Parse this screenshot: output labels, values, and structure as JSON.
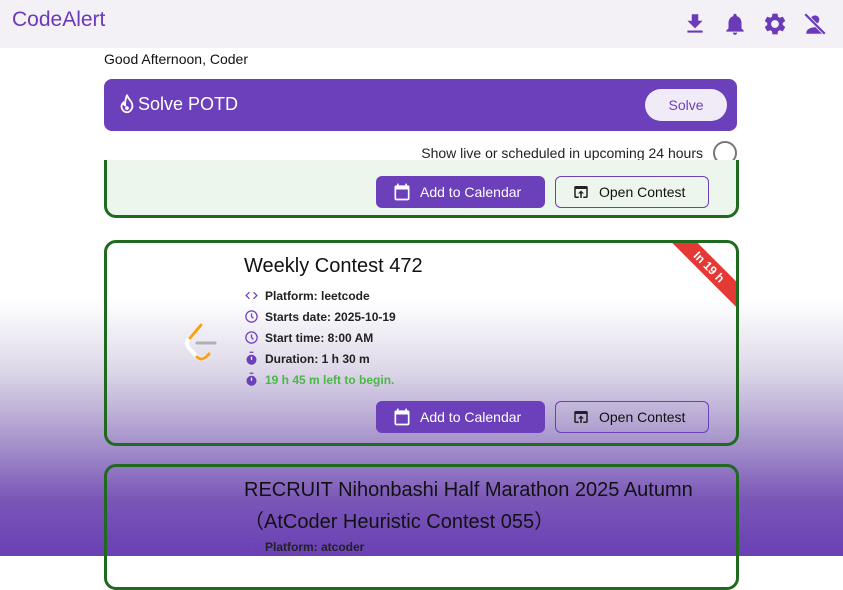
{
  "app": {
    "title": "CodeAlert"
  },
  "header_icons": [
    "download-icon",
    "bell-icon",
    "gear-icon",
    "person-off-icon"
  ],
  "greeting": "Good Afternoon, Coder",
  "potd": {
    "label": "Solve POTD",
    "button": "Solve"
  },
  "filter": {
    "label": "Show live or scheduled in upcoming 24 hours",
    "checked": false
  },
  "buttons": {
    "calendar": "Add to Calendar",
    "open": "Open Contest"
  },
  "contests": [
    {
      "title": "Weekly Contest 472",
      "ribbon": "In 19 h",
      "platform": "Platform: leetcode",
      "starts_date": "Starts date: 2025-10-19",
      "start_time": "Start time: 8:00 AM",
      "duration": "Duration: 1 h 30 m",
      "time_left": "19 h 45 m left to begin."
    },
    {
      "title_line1": "RECRUIT Nihonbashi Half Marathon 2025 Autumn",
      "title_line2": "（AtCoder Heuristic Contest 055）",
      "platform": "Platform: atcoder"
    }
  ],
  "colors": {
    "primary": "#6c3fbb",
    "border": "#1f6a1f",
    "ribbon": "#e53935",
    "success": "#4cb648"
  }
}
